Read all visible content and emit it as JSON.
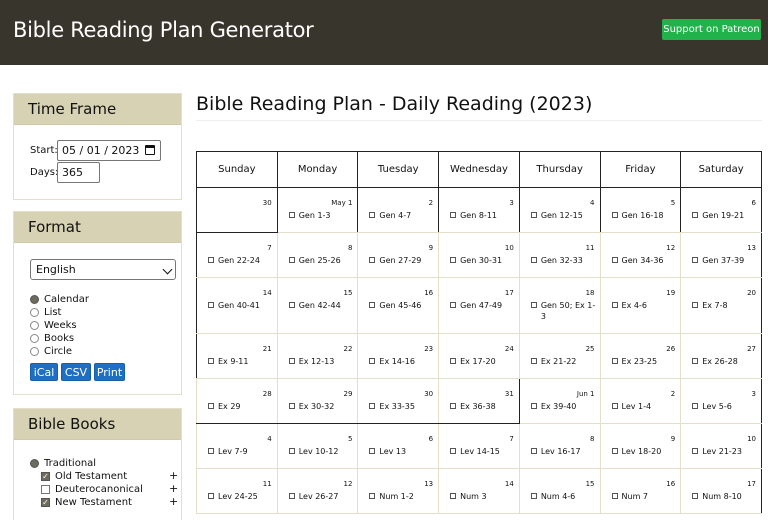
{
  "header": {
    "title": "Bible Reading Plan Generator",
    "patreon_label": "Support on Patreon"
  },
  "timeframe": {
    "heading": "Time Frame",
    "start_label": "Start:",
    "start_value": "05 / 01 / 2023",
    "days_label": "Days:",
    "days_value": "365"
  },
  "format": {
    "heading": "Format",
    "language": "English",
    "options": [
      "Calendar",
      "List",
      "Weeks",
      "Books",
      "Circle"
    ],
    "selected": "Calendar",
    "buttons": [
      "iCal",
      "CSV",
      "Print"
    ]
  },
  "books": {
    "heading": "Bible Books",
    "mode": "Traditional",
    "groups": [
      {
        "label": "Old Testament",
        "checked": true
      },
      {
        "label": "Deuterocanonical",
        "checked": false
      },
      {
        "label": "New Testament",
        "checked": true
      }
    ],
    "plus": "+"
  },
  "main": {
    "title": "Bible Reading Plan - Daily Reading (2023)"
  },
  "calendar": {
    "days": [
      "Sunday",
      "Monday",
      "Tuesday",
      "Wednesday",
      "Thursday",
      "Friday",
      "Saturday"
    ],
    "weeks": [
      [
        {
          "d": "30",
          "r": ""
        },
        {
          "d": "May 1",
          "r": "Gen 1-3"
        },
        {
          "d": "2",
          "r": "Gen 4-7"
        },
        {
          "d": "3",
          "r": "Gen 8-11"
        },
        {
          "d": "4",
          "r": "Gen 12-15"
        },
        {
          "d": "5",
          "r": "Gen 16-18"
        },
        {
          "d": "6",
          "r": "Gen 19-21"
        }
      ],
      [
        {
          "d": "7",
          "r": "Gen 22-24"
        },
        {
          "d": "8",
          "r": "Gen 25-26"
        },
        {
          "d": "9",
          "r": "Gen 27-29"
        },
        {
          "d": "10",
          "r": "Gen 30-31"
        },
        {
          "d": "11",
          "r": "Gen 32-33"
        },
        {
          "d": "12",
          "r": "Gen 34-36"
        },
        {
          "d": "13",
          "r": "Gen 37-39"
        }
      ],
      [
        {
          "d": "14",
          "r": "Gen 40-41"
        },
        {
          "d": "15",
          "r": "Gen 42-44"
        },
        {
          "d": "16",
          "r": "Gen 45-46"
        },
        {
          "d": "17",
          "r": "Gen 47-49"
        },
        {
          "d": "18",
          "r": "Gen 50; Ex 1-3"
        },
        {
          "d": "19",
          "r": "Ex 4-6"
        },
        {
          "d": "20",
          "r": "Ex 7-8"
        }
      ],
      [
        {
          "d": "21",
          "r": "Ex 9-11"
        },
        {
          "d": "22",
          "r": "Ex 12-13"
        },
        {
          "d": "23",
          "r": "Ex 14-16"
        },
        {
          "d": "24",
          "r": "Ex 17-20"
        },
        {
          "d": "25",
          "r": "Ex 21-22"
        },
        {
          "d": "26",
          "r": "Ex 23-25"
        },
        {
          "d": "27",
          "r": "Ex 26-28"
        }
      ],
      [
        {
          "d": "28",
          "r": "Ex 29"
        },
        {
          "d": "29",
          "r": "Ex 30-32"
        },
        {
          "d": "30",
          "r": "Ex 33-35"
        },
        {
          "d": "31",
          "r": "Ex 36-38"
        },
        {
          "d": "Jun 1",
          "r": "Ex 39-40"
        },
        {
          "d": "2",
          "r": "Lev 1-4"
        },
        {
          "d": "3",
          "r": "Lev 5-6"
        }
      ],
      [
        {
          "d": "4",
          "r": "Lev 7-9"
        },
        {
          "d": "5",
          "r": "Lev 10-12"
        },
        {
          "d": "6",
          "r": "Lev 13"
        },
        {
          "d": "7",
          "r": "Lev 14-15"
        },
        {
          "d": "8",
          "r": "Lev 16-17"
        },
        {
          "d": "9",
          "r": "Lev 18-20"
        },
        {
          "d": "10",
          "r": "Lev 21-23"
        }
      ],
      [
        {
          "d": "11",
          "r": "Lev 24-25"
        },
        {
          "d": "12",
          "r": "Lev 26-27"
        },
        {
          "d": "13",
          "r": "Num 1-2"
        },
        {
          "d": "14",
          "r": "Num 3"
        },
        {
          "d": "15",
          "r": "Num 4-6"
        },
        {
          "d": "16",
          "r": "Num 7"
        },
        {
          "d": "17",
          "r": "Num 8-10"
        }
      ]
    ]
  }
}
